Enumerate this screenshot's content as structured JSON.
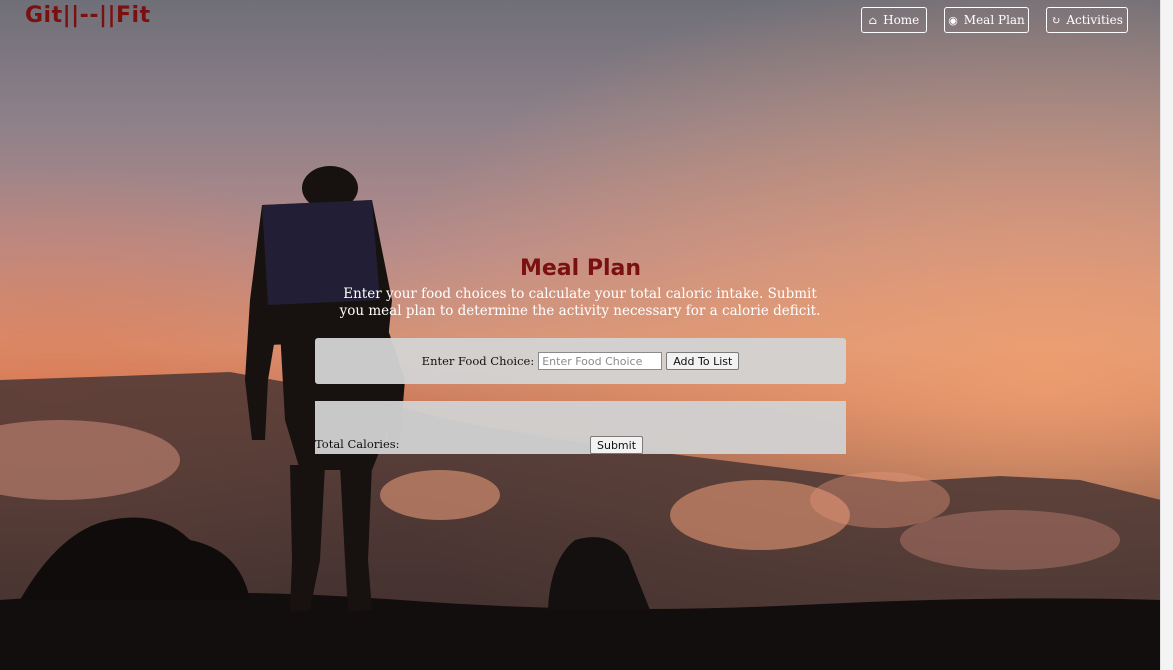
{
  "app": {
    "brand": "Git||--||Fit"
  },
  "nav": {
    "items": [
      {
        "label": "Home",
        "icon": "home-icon"
      },
      {
        "label": "Meal Plan",
        "icon": "github-icon"
      },
      {
        "label": "Activities",
        "icon": "refresh-icon"
      }
    ]
  },
  "main": {
    "title": "Meal Plan",
    "subtitle": "Enter your food choices to calculate your total caloric intake. Submit you meal plan to determine the activity necessary for a calorie deficit.",
    "form": {
      "label": "Enter Food Choice:",
      "input_value": "",
      "input_placeholder": "Enter Food Choice",
      "add_button": "Add To List"
    },
    "totals": {
      "label": "Total Calories:",
      "submit_button": "Submit"
    }
  },
  "colors": {
    "brand": "#7a1010",
    "title": "#7a1010",
    "panel": "#d2d2d2"
  }
}
